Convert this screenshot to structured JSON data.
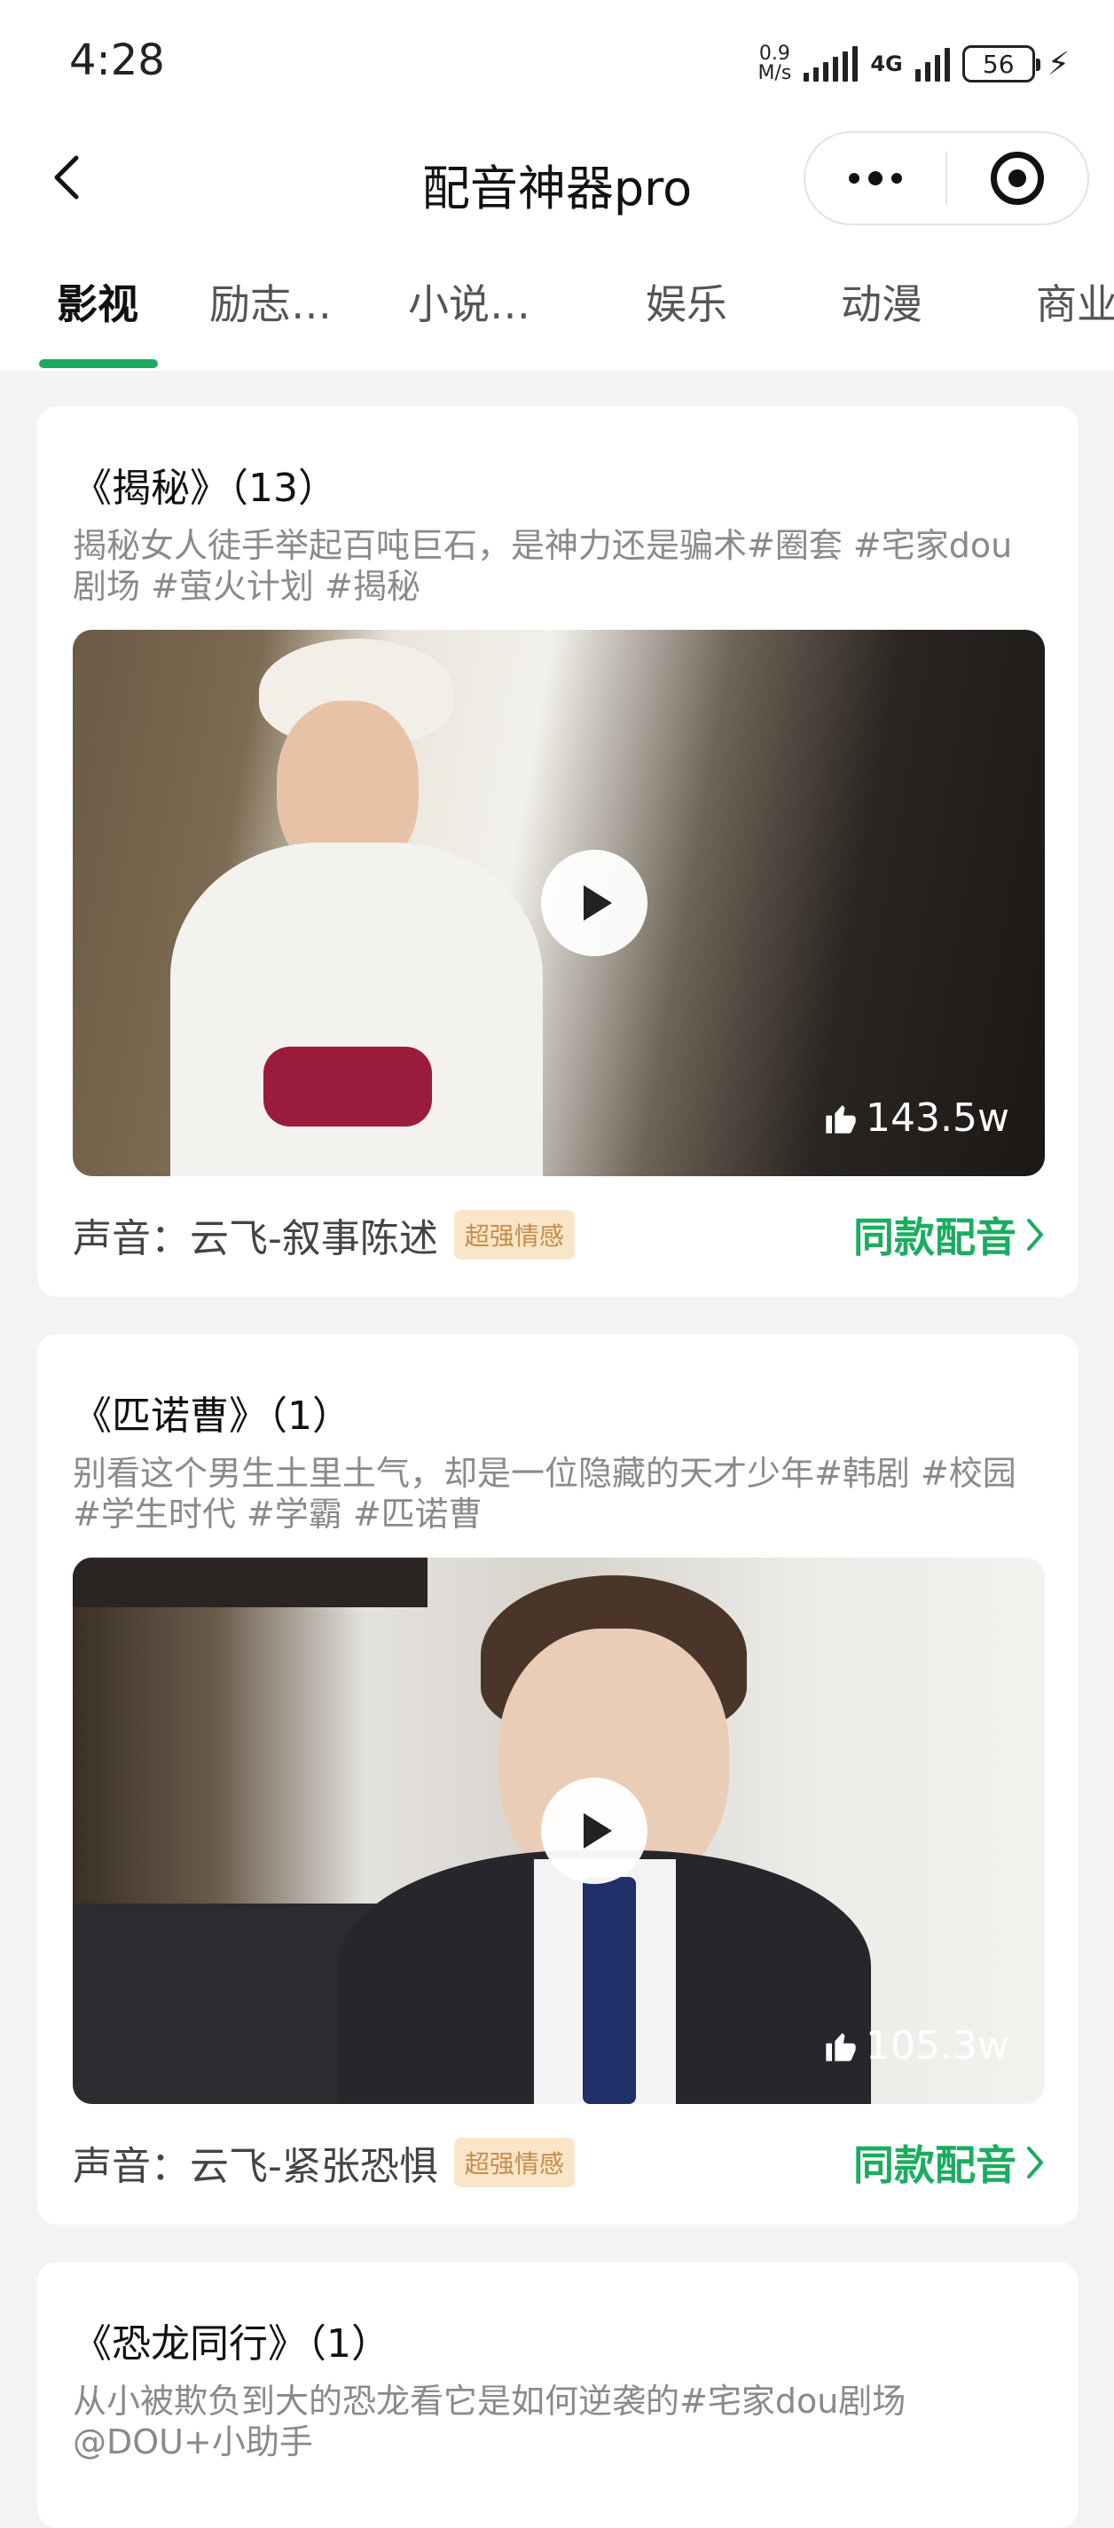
{
  "status_bar": {
    "time": "4:28",
    "net_speed_value": "0.9",
    "net_speed_unit": "M/s",
    "network_type": "4G",
    "battery": "56"
  },
  "nav": {
    "title": "配音神器pro"
  },
  "tabs": [
    {
      "label": "影视",
      "active": true
    },
    {
      "label": "励志…",
      "active": false
    },
    {
      "label": "小说…",
      "active": false
    },
    {
      "label": "娱乐",
      "active": false
    },
    {
      "label": "动漫",
      "active": false
    },
    {
      "label": "商业",
      "active": false
    }
  ],
  "cards": [
    {
      "title": "《揭秘》（13）",
      "description": "揭秘女人徒手举起百吨巨石，是神力还是骗术#圈套 #宅家dou剧场 #萤火计划 #揭秘",
      "likes": "143.5w",
      "voice": "声音：云飞-叙事陈述",
      "badge": "超强情感",
      "action": "同款配音"
    },
    {
      "title": "《匹诺曹》（1）",
      "description": "别看这个男生土里土气，却是一位隐藏的天才少年#韩剧 #校园 #学生时代 #学霸 #匹诺曹",
      "likes": "105.3w",
      "voice": "声音：云飞-紧张恐惧",
      "badge": "超强情感",
      "action": "同款配音"
    },
    {
      "title": "《恐龙同行》（1）",
      "description": "从小被欺负到大的恐龙看它是如何逆袭的#宅家dou剧场 @DOU+小助手"
    }
  ],
  "colors": {
    "accent": "#1aad5f",
    "badge_bg": "#f9e6c9",
    "badge_text": "#c88b4a"
  }
}
